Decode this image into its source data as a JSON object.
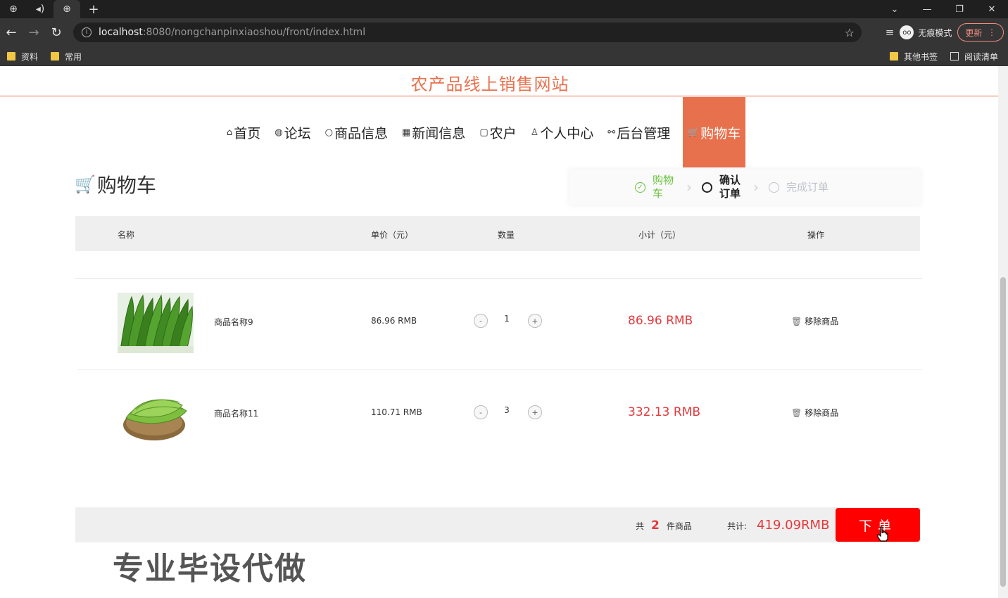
{
  "browser": {
    "address": {
      "host": "localhost",
      "path": ":8080/nongchanpinxiaoshou/front/index.html"
    },
    "incognito_label": "无痕模式",
    "update_label": "更新",
    "bookmarks": [
      "资料",
      "常用"
    ],
    "other_bookmarks": "其他书签",
    "reading_list": "阅读清单"
  },
  "site": {
    "title": "农产品线上销售网站",
    "nav": [
      {
        "label": "首页",
        "icon": "home-icon",
        "glyph": "⌂"
      },
      {
        "label": "论坛",
        "icon": "globe-icon",
        "glyph": "◍"
      },
      {
        "label": "商品信息",
        "icon": "circle-icon",
        "glyph": "○"
      },
      {
        "label": "新闻信息",
        "icon": "grid-icon",
        "glyph": "▦"
      },
      {
        "label": "农户",
        "icon": "card-icon",
        "glyph": "▢"
      },
      {
        "label": "个人中心",
        "icon": "user-icon",
        "glyph": "♙"
      },
      {
        "label": "后台管理",
        "icon": "link-icon",
        "glyph": "⚯"
      },
      {
        "label": "购物车",
        "icon": "cart-icon",
        "glyph": "🛒",
        "active": true
      }
    ]
  },
  "cart": {
    "heading": "购物车",
    "steps": [
      {
        "label": "购物车",
        "state": "done"
      },
      {
        "label": "确认订单",
        "state": "current"
      },
      {
        "label": "完成订单",
        "state": "todo"
      }
    ],
    "columns": {
      "name": "名称",
      "price": "单价（元）",
      "qty": "数量",
      "subtotal": "小计（元）",
      "action": "操作"
    },
    "items": [
      {
        "name": "商品名称9",
        "price": "86.96 RMB",
        "qty": "1",
        "subtotal": "86.96 RMB",
        "remove": "移除商品",
        "image": "leafy-greens"
      },
      {
        "name": "商品名称11",
        "price": "110.71 RMB",
        "qty": "3",
        "subtotal": "332.13 RMB",
        "remove": "移除商品",
        "image": "bitter-melon"
      }
    ],
    "summary": {
      "count_prefix": "共",
      "count": "2",
      "count_suffix": "件商品",
      "total_label": "共计:",
      "total": "419.09RMB"
    },
    "order_button": "下单"
  },
  "overlay": {
    "watermark": "专业毕设代做"
  },
  "colors": {
    "accent": "#e8714d",
    "price_red": "#e4393c",
    "order_red": "#ff0000",
    "done_green": "#67c23a"
  }
}
